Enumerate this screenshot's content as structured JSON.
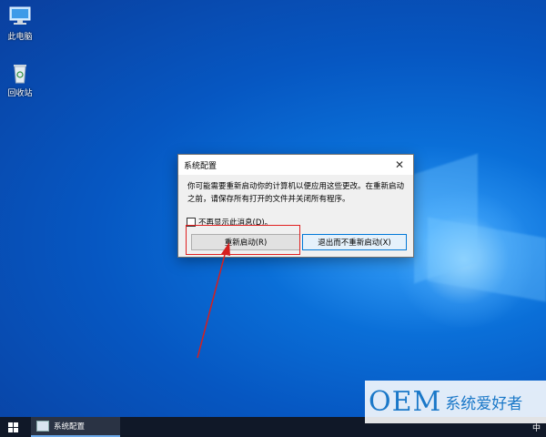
{
  "desktop": {
    "icons": [
      {
        "label": "此电脑",
        "icon": "computer-icon"
      },
      {
        "label": "回收站",
        "icon": "recycle-bin-icon"
      }
    ]
  },
  "dialog": {
    "title": "系统配置",
    "message": "你可能需要重新启动你的计算机以便应用这些更改。在重新启动之前，请保存所有打开的文件并关闭所有程序。",
    "checkbox_label": "不再显示此消息(D)。",
    "checkbox_checked": false,
    "restart_button": "重新启动(R)",
    "exit_button": "退出而不重新启动(X)"
  },
  "taskbar": {
    "start_icon": "windows-logo-icon",
    "app_label": "系统配置",
    "tray_ime": "中"
  },
  "watermark": {
    "oem": "OEM",
    "text": "系统爱好者"
  },
  "colors": {
    "highlight": "#e02020",
    "arrow": "#d42020",
    "desktop": "#0657c2"
  }
}
